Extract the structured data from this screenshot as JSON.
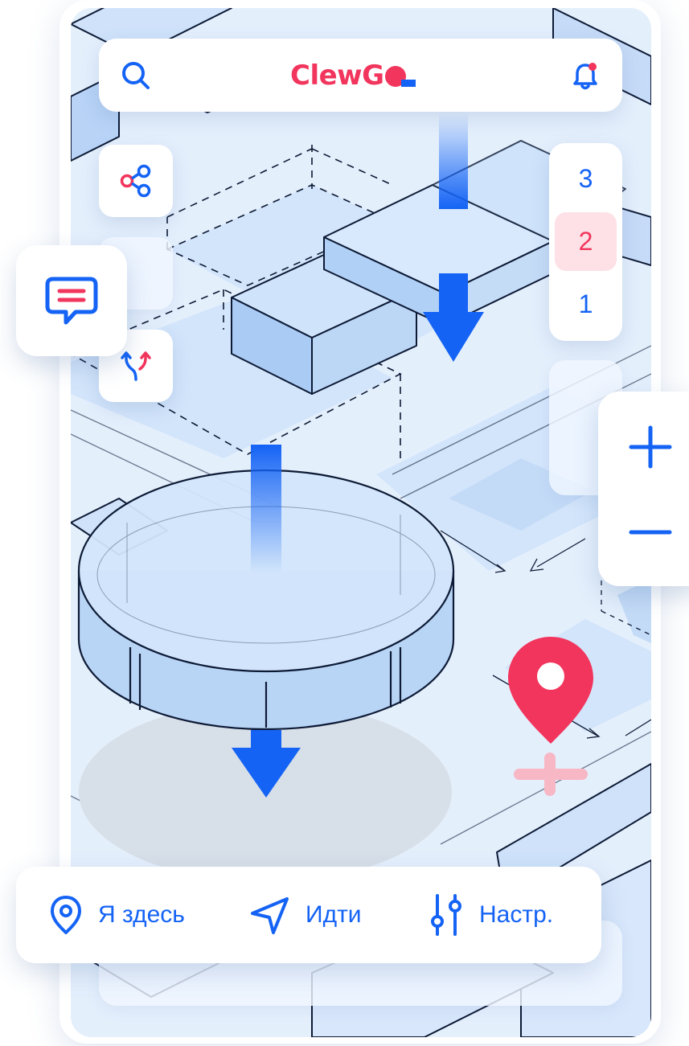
{
  "brand": {
    "logo_text": "ClewG",
    "logo_colors": {
      "text": "#f2355c",
      "accent": "#1463f5"
    }
  },
  "colors": {
    "primary": "#1463f5",
    "accent": "#f2355c",
    "map_bg": "#e4effc",
    "active_floor_bg": "#fde1e6"
  },
  "header": {
    "search_icon": "search-icon",
    "notification_icon": "bell-icon",
    "has_unread_notification": true
  },
  "side_actions": [
    {
      "id": "share",
      "icon": "share-icon"
    },
    {
      "id": "chat",
      "icon": "chat-icon"
    },
    {
      "id": "route",
      "icon": "route-split-icon"
    }
  ],
  "floors": {
    "items": [
      "3",
      "2",
      "1"
    ],
    "selected": "2"
  },
  "zoom": {
    "in_icon": "plus-icon",
    "out_icon": "minus-icon"
  },
  "map": {
    "marker_icon": "location-pin-icon",
    "secondary_marker_icon": "plus-icon"
  },
  "bottom_nav": [
    {
      "id": "here",
      "icon": "location-icon",
      "label": "Я здесь"
    },
    {
      "id": "go",
      "icon": "navigation-arrow-icon",
      "label": "Идти"
    },
    {
      "id": "settings",
      "icon": "sliders-icon",
      "label": "Настр."
    }
  ]
}
